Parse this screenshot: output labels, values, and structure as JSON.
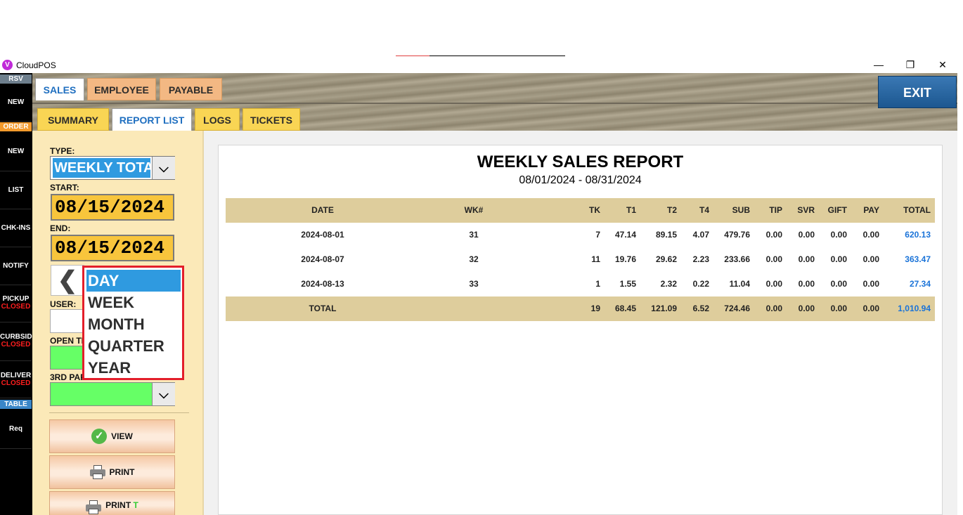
{
  "window": {
    "title": "CloudPOS",
    "logo_letter": "V",
    "minimize": "—",
    "restore": "❐",
    "close": "✕"
  },
  "leftbar": {
    "rsv_header": "RSV",
    "rsv_new": "NEW",
    "order_header": "ORDER",
    "order_new": "NEW",
    "list": "LIST",
    "chk_ins": "CHK-INS",
    "notify": "NOTIFY",
    "pickup": "PICKUP",
    "pickup_status": "CLOSED",
    "curbside": "CURBSID",
    "curbside_status": "CLOSED",
    "delivery": "DELIVER",
    "delivery_status": "CLOSED",
    "table_header": "TABLE",
    "req": "Req",
    "colors": {
      "rsv": "#6e7f8d",
      "order": "#f39a2c",
      "table": "#3a86c8"
    }
  },
  "tabs": {
    "top": [
      "SALES",
      "EMPLOYEE",
      "PAYABLE"
    ],
    "sub": [
      "SUMMARY",
      "REPORT LIST",
      "LOGS",
      "TICKETS"
    ],
    "exit": "EXIT"
  },
  "filters": {
    "type_label": "TYPE:",
    "type_value": "WEEKLY TOTA",
    "start_label": "START:",
    "start_value": "08/15/2024",
    "end_label": "END:",
    "end_value": "08/15/2024",
    "prev_symbol": "❮",
    "user_label": "USER:",
    "open_label": "OPEN TI",
    "third_party_label": "3RD PAR",
    "dropdown_arrow": "⌵"
  },
  "period_dropdown": {
    "options": [
      "DAY",
      "WEEK",
      "MONTH",
      "QUARTER",
      "YEAR"
    ],
    "selected": "DAY"
  },
  "actions": {
    "view": "VIEW",
    "print": "PRINT",
    "print_t": "PRINT",
    "print_t_suffix": "T",
    "check_symbol": "✓"
  },
  "report": {
    "title": "WEEKLY SALES REPORT",
    "range": "08/01/2024 - 08/31/2024",
    "columns": [
      "DATE",
      "WK#",
      "TK",
      "T1",
      "T2",
      "T4",
      "SUB",
      "TIP",
      "SVR",
      "GIFT",
      "PAY",
      "TOTAL"
    ],
    "rows": [
      [
        "2024-08-01",
        "31",
        "7",
        "47.14",
        "89.15",
        "4.07",
        "479.76",
        "0.00",
        "0.00",
        "0.00",
        "0.00",
        "620.13"
      ],
      [
        "2024-08-07",
        "32",
        "11",
        "19.76",
        "29.62",
        "2.23",
        "233.66",
        "0.00",
        "0.00",
        "0.00",
        "0.00",
        "363.47"
      ],
      [
        "2024-08-13",
        "33",
        "1",
        "1.55",
        "2.32",
        "0.22",
        "11.04",
        "0.00",
        "0.00",
        "0.00",
        "0.00",
        "27.34"
      ]
    ],
    "total_row": [
      "TOTAL",
      "",
      "19",
      "68.45",
      "121.09",
      "6.52",
      "724.46",
      "0.00",
      "0.00",
      "0.00",
      "0.00",
      "1,010.94"
    ]
  }
}
